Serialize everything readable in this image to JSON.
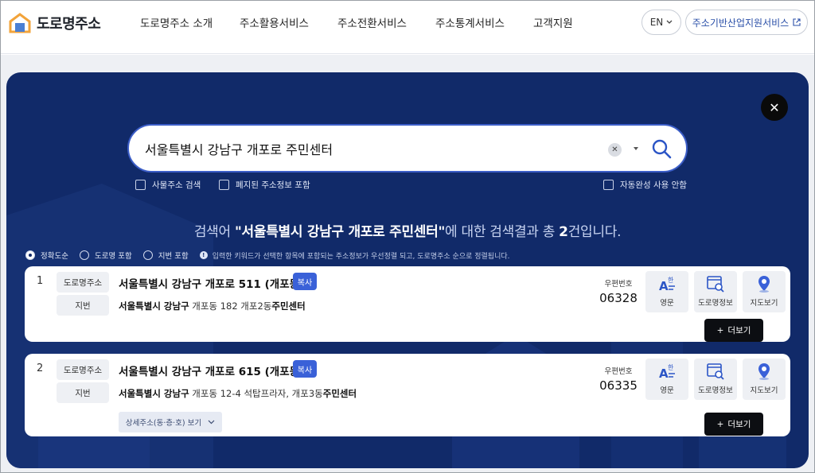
{
  "header": {
    "logo_text": "도로명주소",
    "nav": [
      "도로명주소 소개",
      "주소활용서비스",
      "주소전환서비스",
      "주소통계서비스",
      "고객지원"
    ],
    "lang_label": "EN",
    "support_label": "주소기반산업지원서비스"
  },
  "search": {
    "query": "서울특별시 강남구 개포로 주민센터",
    "options": {
      "building_search": "사물주소 검색",
      "include_abolished": "폐지된 주소정보 포함",
      "autocomplete_off": "자동완성 사용 안함"
    }
  },
  "results": {
    "heading_prefix": "검색어 ",
    "heading_query": "\"서울특별시 강남구 개포로 주민센터\"",
    "heading_mid": "에 대한 검색결과 총 ",
    "heading_count": "2",
    "heading_suffix": "건입니다.",
    "sort": {
      "accuracy": "정확도순",
      "road_included": "도로명 포함",
      "lot_included": "지번 포함",
      "note": "입력한 키워드가 선택한 항목에 포함되는 주소정보가 우선정렬 되고, 도로명주소 순으로 정렬됩니다."
    },
    "labels": {
      "road_tag": "도로명주소",
      "lot_tag": "지번",
      "copy": "복사",
      "zip_label": "우편번호",
      "eng": "영문",
      "road_info": "도로명정보",
      "map": "지도보기",
      "more": "더보기",
      "detail": "상세주소(동·층·호) 보기"
    },
    "items": [
      {
        "num": "1",
        "road": "서울특별시 강남구 개포로 511 (개포동)",
        "lot_bold": "서울특별시 강남구",
        "lot_rest": " 개포동 182 개포2동",
        "lot_tail": "주민센터",
        "zip": "06328"
      },
      {
        "num": "2",
        "road": "서울특별시 강남구 개포로 615 (개포동)",
        "lot_bold": "서울특별시 강남구",
        "lot_rest": " 개포동 12-4 석탑프라자, 개포3동",
        "lot_tail": "주민센터",
        "zip": "06335"
      }
    ]
  },
  "colors": {
    "modal_bg": "#112a69",
    "accent": "#3a61d8",
    "dark_button": "#0c0e12"
  }
}
